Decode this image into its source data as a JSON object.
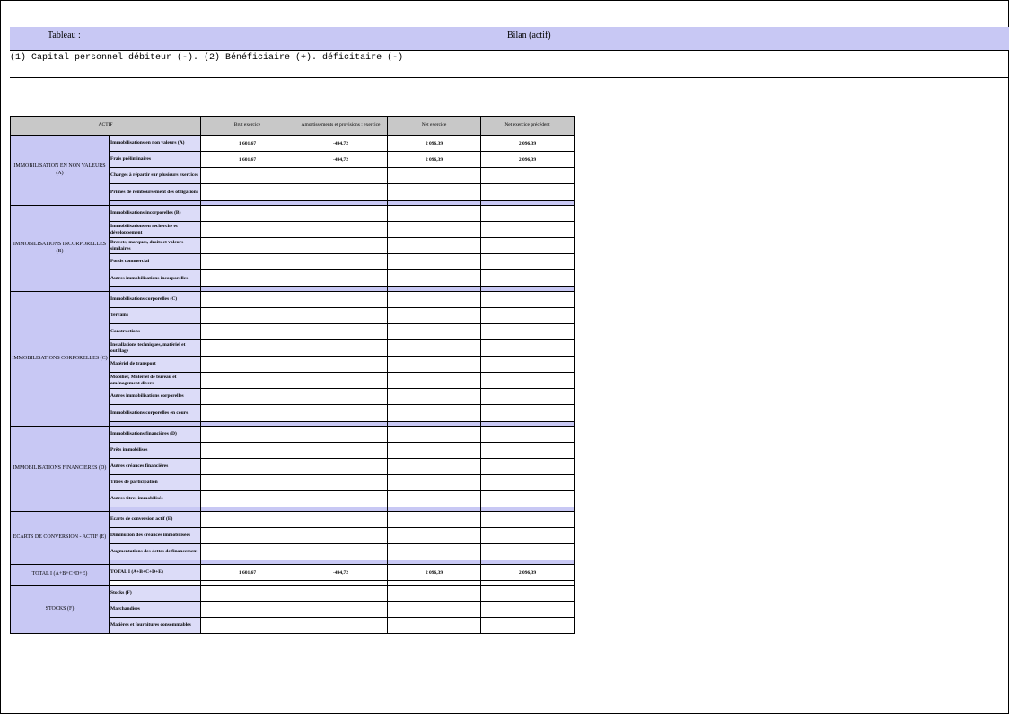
{
  "header": {
    "tableau_label": "Tableau :",
    "title": "Bilan (actif)"
  },
  "note": "(1) Capital personnel débiteur (-). (2) Bénéficiaire (+). déficitaire (-)",
  "table": {
    "columns": [
      "ACTIF",
      "Brut exercice",
      "Amortissements et provisions : exercice",
      "Net exercice",
      "Net exercice précédent"
    ],
    "sections": [
      {
        "name": "IMMOBILISATION EN NON VALEURS (A)",
        "rows": [
          {
            "label": "Immobilisations en non valeurs (A)",
            "values": [
              "1 601,67",
              "-494,72",
              "2 096,39",
              "2 096,39"
            ]
          },
          {
            "label": "Frais préliminaires",
            "values": [
              "1 601,67",
              "-494,72",
              "2 096,39",
              "2 096,39"
            ]
          },
          {
            "label": "Charges à répartir sur plusieurs exercices",
            "values": [
              "",
              "",
              "",
              ""
            ]
          },
          {
            "label": "Primes de remboursement des obligations",
            "values": [
              "",
              "",
              "",
              ""
            ]
          }
        ]
      },
      {
        "name": "IMMOBILISATIONS INCORPORELLES (B)",
        "rows": [
          {
            "label": "Immobilisations incorporelles (B)",
            "values": [
              "",
              "",
              "",
              ""
            ]
          },
          {
            "label": "Immobilisations en recherche et développement",
            "values": [
              "",
              "",
              "",
              ""
            ]
          },
          {
            "label": "Brevets, marques, droits et valeurs similaires",
            "values": [
              "",
              "",
              "",
              ""
            ]
          },
          {
            "label": "Fonds commercial",
            "values": [
              "",
              "",
              "",
              ""
            ]
          },
          {
            "label": "Autres immobilisations incorporelles",
            "values": [
              "",
              "",
              "",
              ""
            ]
          }
        ]
      },
      {
        "name": "IMMOBILISATIONS CORPORELLES (C)",
        "rows": [
          {
            "label": "Immobilisations corporelles (C)",
            "values": [
              "",
              "",
              "",
              ""
            ]
          },
          {
            "label": "Terrains",
            "values": [
              "",
              "",
              "",
              ""
            ]
          },
          {
            "label": "Constructions",
            "values": [
              "",
              "",
              "",
              ""
            ]
          },
          {
            "label": "Installations techniques, matériel et outillage",
            "values": [
              "",
              "",
              "",
              ""
            ]
          },
          {
            "label": "Matériel de transport",
            "values": [
              "",
              "",
              "",
              ""
            ]
          },
          {
            "label": "Mobilier, Matériel de bureau et aménagement divers",
            "values": [
              "",
              "",
              "",
              ""
            ]
          },
          {
            "label": "Autres immobilisations corporelles",
            "values": [
              "",
              "",
              "",
              ""
            ]
          },
          {
            "label": "Immobilisations corporelles en cours",
            "values": [
              "",
              "",
              "",
              ""
            ]
          }
        ]
      },
      {
        "name": "IMMOBILISATIONS FINANCIERES (D)",
        "rows": [
          {
            "label": "Immobilisations financières (D)",
            "values": [
              "",
              "",
              "",
              ""
            ]
          },
          {
            "label": "Prêts immobilisés",
            "values": [
              "",
              "",
              "",
              ""
            ]
          },
          {
            "label": "Autres créances financières",
            "values": [
              "",
              "",
              "",
              ""
            ]
          },
          {
            "label": "Titres de participation",
            "values": [
              "",
              "",
              "",
              ""
            ]
          },
          {
            "label": "Autres titres immobilisés",
            "values": [
              "",
              "",
              "",
              ""
            ]
          }
        ]
      },
      {
        "name": "ECARTS DE CONVERSION - ACTIF (E)",
        "rows": [
          {
            "label": "Ecarts de conversion   actif (E)",
            "values": [
              "",
              "",
              "",
              ""
            ]
          },
          {
            "label": "Diminution des créances immobilisées",
            "values": [
              "",
              "",
              "",
              ""
            ]
          },
          {
            "label": "Augmentations des dettes de financement",
            "values": [
              "",
              "",
              "",
              ""
            ]
          }
        ]
      },
      {
        "name": "TOTAL I (A+B+C+D+E)",
        "rows": [
          {
            "label": "TOTAL I (A+B+C+D+E)",
            "values": [
              "1 601,67",
              "-494,72",
              "2 096,39",
              "2 096,39"
            ]
          }
        ]
      },
      {
        "name": "STOCKS (F)",
        "rows": [
          {
            "label": "Stocks (F)",
            "values": [
              "",
              "",
              "",
              ""
            ]
          },
          {
            "label": "Marchandises",
            "values": [
              "",
              "",
              "",
              ""
            ]
          },
          {
            "label": "Matières et fournitures consommables",
            "values": [
              "",
              "",
              "",
              ""
            ]
          }
        ]
      }
    ]
  }
}
